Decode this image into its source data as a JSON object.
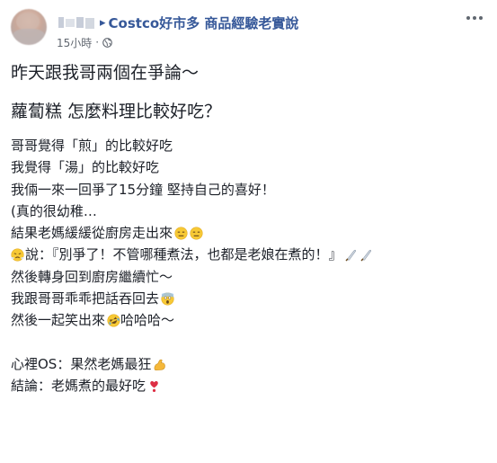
{
  "post": {
    "group_name": "Costco好市多 商品經驗老實說",
    "caret_glyph": "▸",
    "time": "15小時",
    "meta_dot": "·",
    "privacy_icon": "globe-icon",
    "headline1": "昨天跟我哥兩個在爭論～",
    "headline2": "蘿蔔糕 怎麼料理比較好吃？",
    "lines": [
      "哥哥覺得「煎」的比較好吃",
      "我覺得「湯」的比較好吃",
      "我倆一來一回爭了15分鐘 堅持自己的喜好！",
      "(真的很幼稚…",
      "結果老媽緩緩從廚房走出來",
      "說：『別爭了！不管哪種煮法，也都是老娘在煮的！』",
      "然後轉身回到廚房繼續忙～",
      "我跟哥哥乖乖把話吞回去",
      "然後一起笑出來",
      " 哈哈哈～",
      "心裡OS：果然老媽最狂",
      "結論：老媽煮的最好吃"
    ],
    "emoji_names": {
      "expressionless": "expressionless-face-emoji",
      "steam": "face-with-steam-emoji",
      "knife": "kitchen-knife-emoji",
      "scream": "screaming-face-emoji",
      "rofl": "rolling-on-floor-laughing-emoji",
      "muscle": "flexed-biceps-emoji",
      "heart": "heavy-heart-exclamation-emoji"
    },
    "colors": {
      "link": "#365899",
      "text": "#1d2129",
      "meta": "#616770"
    }
  }
}
